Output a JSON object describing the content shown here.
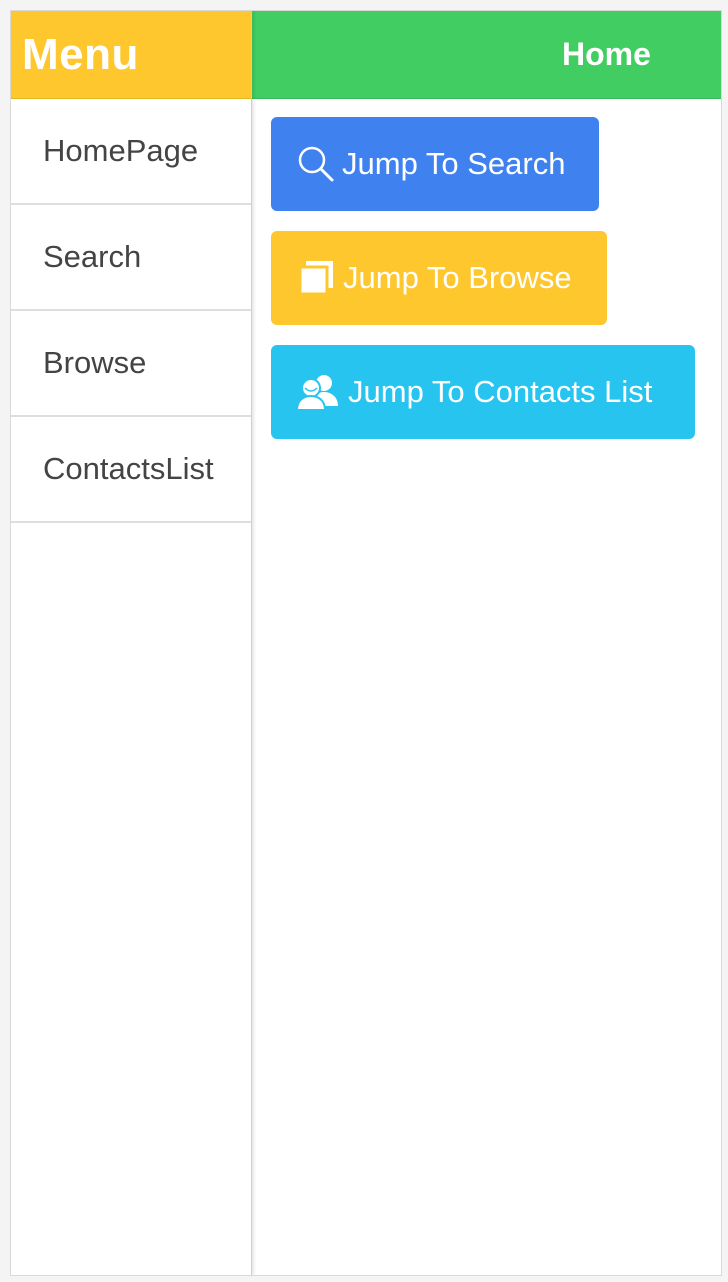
{
  "colors": {
    "menu_header": "#ffc72e",
    "main_header": "#41cd62",
    "search_button": "#3f82ef",
    "browse_button": "#ffc72e",
    "contacts_button": "#27c4ef"
  },
  "sidebar": {
    "title": "Menu",
    "items": [
      {
        "label": "HomePage"
      },
      {
        "label": "Search"
      },
      {
        "label": "Browse"
      },
      {
        "label": "ContactsList"
      }
    ]
  },
  "main": {
    "title": "Home",
    "buttons": {
      "search": {
        "label": "Jump To Search",
        "icon": "search-icon"
      },
      "browse": {
        "label": "Jump To Browse",
        "icon": "browse-icon"
      },
      "contacts": {
        "label": "Jump To Contacts List",
        "icon": "contacts-icon"
      }
    }
  }
}
